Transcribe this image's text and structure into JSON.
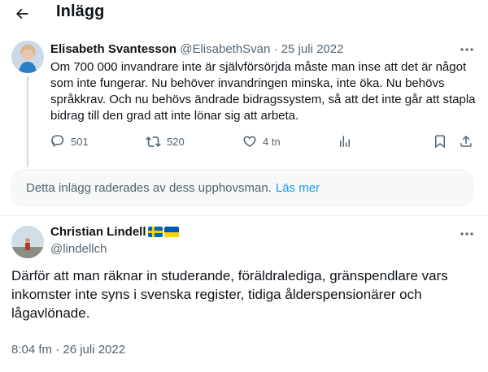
{
  "header": {
    "title": "Inlägg",
    "back_icon": "arrow-left-icon"
  },
  "quoted_post": {
    "author_name": "Elisabeth Svantesson",
    "author_handle": "@ElisabethSvan",
    "separator": "·",
    "date": "25 juli 2022",
    "text": "Om 700 000 invandrare inte är självförsörjda måste man inse att det är något som inte fungerar. Nu behöver invandringen minska, inte öka. Nu behövs språkkrav. Och nu behövs ändrade bidragssystem, så att det inte går att stapla bidrag till den grad att inte lönar sig att arbeta.",
    "actions": {
      "replies": "501",
      "reposts": "520",
      "likes": "4 tn"
    }
  },
  "deleted_notice": {
    "text": "Detta inlägg raderades av dess upphovsman.",
    "link": "Läs mer"
  },
  "main_post": {
    "author_name": "Christian Lindell",
    "author_handle": "@lindellch",
    "text": "Därför att man räknar in studerande, föräldralediga, gränspendlare vars inkomster inte syns i svenska register, tidiga ålderspensionärer och lågavlönade.",
    "timestamp": "8:04 fm · 26 juli 2022"
  },
  "colors": {
    "text": "#0f1419",
    "secondary": "#536471",
    "accent": "#1d9bf0",
    "border": "#eff3f4"
  }
}
